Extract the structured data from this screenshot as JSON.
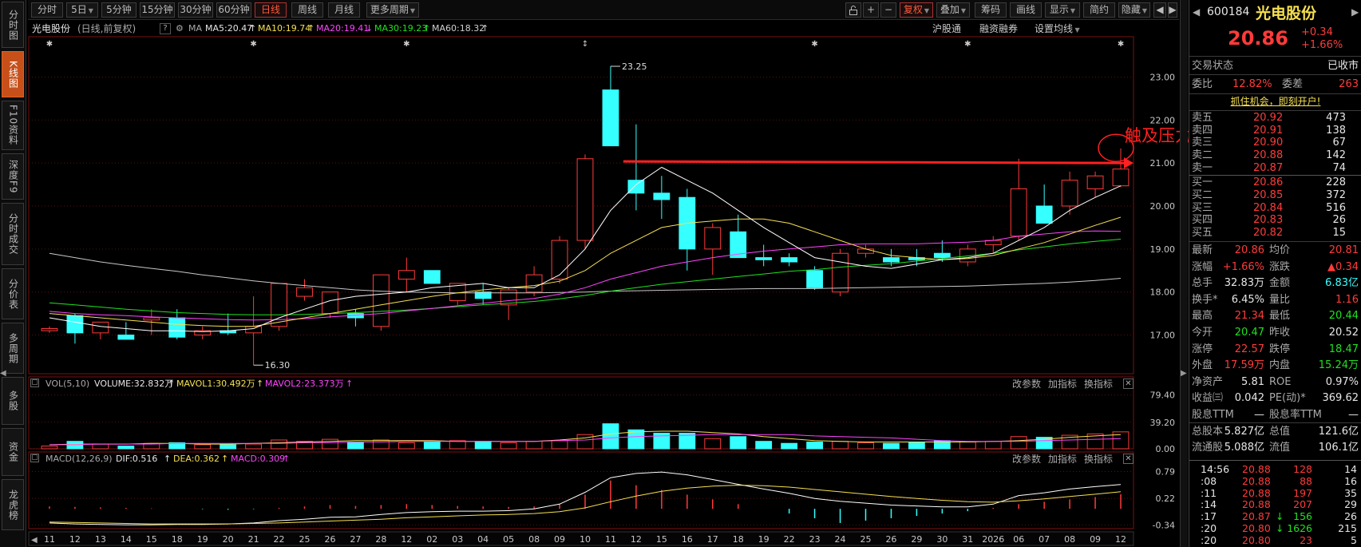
{
  "toolbar": {
    "left": [
      "分时",
      "5日",
      "5分钟",
      "15分钟",
      "30分钟",
      "60分钟",
      "日线",
      "周线",
      "月线",
      "更多周期"
    ],
    "right": [
      "复权",
      "叠加",
      "筹码",
      "画线",
      "显示",
      "简约",
      "隐藏"
    ],
    "icons": [
      "unlock-icon",
      "plus-icon",
      "minus-icon"
    ]
  },
  "left_tabs": [
    "分时图",
    "K线图",
    "F10资料",
    "深度F9",
    "分时成交",
    "分价表",
    "多周期",
    "多股",
    "资金",
    "龙虎榜"
  ],
  "header": {
    "stock_name": "光电股份",
    "mode": "(日线,前复权)",
    "ma_label": "MA",
    "ma5": "MA5:20.47",
    "ma10": "MA10:19.74",
    "ma20": "MA20:19.41",
    "ma30": "MA30:19.23",
    "ma60": "MA60:18.32",
    "links": [
      "沪股通",
      "融资融券",
      "设置均线"
    ]
  },
  "volume_header": {
    "label": "VOL(5,10)",
    "volume": "VOLUME:32.832万",
    "mavol1": "MAVOL1:30.492万",
    "mavol2": "MAVOL2:23.373万",
    "links": [
      "改参数",
      "加指标",
      "换指标"
    ]
  },
  "macd_header": {
    "label": "MACD(12,26,9)",
    "dif": "DIF:0.516",
    "dea": "DEA:0.362",
    "macd": "MACD:0.309",
    "links": [
      "改参数",
      "加指标",
      "换指标"
    ]
  },
  "annotation": {
    "text": "触及压力",
    "color": "#ff2020"
  },
  "colors": {
    "up": "#ff3b3b",
    "down": "#35ffff",
    "ma5": "#ffffff",
    "ma10": "#f5e050",
    "ma20": "#ff44ff",
    "ma30": "#1fe21f",
    "ma60": "#c8c8c8"
  },
  "chart_data": {
    "type": "candlestick",
    "x": [
      "11",
      "12",
      "13",
      "14",
      "15",
      "18",
      "19",
      "20",
      "21",
      "22",
      "25",
      "26",
      "27",
      "28",
      "12",
      "02",
      "03",
      "04",
      "05",
      "08",
      "09",
      "10",
      "11",
      "12",
      "15",
      "16",
      "17",
      "18",
      "19",
      "22",
      "23",
      "24",
      "25",
      "26",
      "29",
      "30",
      "31",
      "2026",
      "06",
      "07",
      "08",
      "09",
      "12"
    ],
    "x_labels": [
      "11",
      "12",
      "13",
      "14",
      "15",
      "18",
      "19",
      "20",
      "21",
      "22",
      "25",
      "26",
      "27",
      "28",
      "12",
      "02",
      "03",
      "04",
      "05",
      "08",
      "09",
      "10",
      "11",
      "12",
      "15",
      "16",
      "17",
      "18",
      "19",
      "22",
      "23",
      "24",
      "25",
      "26",
      "29",
      "30",
      "31",
      "2026",
      "06",
      "07",
      "08",
      "09",
      "12"
    ],
    "ohlc": [
      [
        17.1,
        17.2,
        17.05,
        17.15
      ],
      [
        17.45,
        17.5,
        16.8,
        17.05
      ],
      [
        17.05,
        17.2,
        16.9,
        17.3
      ],
      [
        17.0,
        17.3,
        16.95,
        16.9
      ],
      [
        17.35,
        17.6,
        17.0,
        17.4
      ],
      [
        17.4,
        17.6,
        16.9,
        16.95
      ],
      [
        17.0,
        17.2,
        16.9,
        17.1
      ],
      [
        17.1,
        17.5,
        17.0,
        17.05
      ],
      [
        17.05,
        17.9,
        16.3,
        17.2
      ],
      [
        17.2,
        18.2,
        17.1,
        18.2
      ],
      [
        17.9,
        18.3,
        17.8,
        18.1
      ],
      [
        17.5,
        18.0,
        17.4,
        18.0
      ],
      [
        17.5,
        17.6,
        17.2,
        17.4
      ],
      [
        17.2,
        18.4,
        17.1,
        18.4
      ],
      [
        18.3,
        18.8,
        18.0,
        18.5
      ],
      [
        18.5,
        18.5,
        18.2,
        18.2
      ],
      [
        17.8,
        18.2,
        17.7,
        18.2
      ],
      [
        18.0,
        18.2,
        17.7,
        17.85
      ],
      [
        17.7,
        18.1,
        17.35,
        18.05
      ],
      [
        18.0,
        18.6,
        17.9,
        18.4
      ],
      [
        18.3,
        19.3,
        18.2,
        19.2
      ],
      [
        19.2,
        21.2,
        19.0,
        21.1
      ],
      [
        22.7,
        23.25,
        21.4,
        21.4
      ],
      [
        20.6,
        21.9,
        19.9,
        20.3
      ],
      [
        20.3,
        20.7,
        19.7,
        20.15
      ],
      [
        20.2,
        20.4,
        18.5,
        19.0
      ],
      [
        19.0,
        19.6,
        18.4,
        19.5
      ],
      [
        19.4,
        19.8,
        18.9,
        18.8
      ],
      [
        18.8,
        19.1,
        18.6,
        18.75
      ],
      [
        18.8,
        18.9,
        18.6,
        18.7
      ],
      [
        18.5,
        18.6,
        18.05,
        18.1
      ],
      [
        18.0,
        19.0,
        17.9,
        18.9
      ],
      [
        18.9,
        19.1,
        18.8,
        19.0
      ],
      [
        18.8,
        19.0,
        18.6,
        18.7
      ],
      [
        18.8,
        19.0,
        18.6,
        18.75
      ],
      [
        18.9,
        19.2,
        18.7,
        18.8
      ],
      [
        18.7,
        19.1,
        18.6,
        19.0
      ],
      [
        19.1,
        19.3,
        18.9,
        19.2
      ],
      [
        19.3,
        21.1,
        19.2,
        20.4
      ],
      [
        20.0,
        20.5,
        19.6,
        19.6
      ],
      [
        20.0,
        20.8,
        19.8,
        20.6
      ],
      [
        20.4,
        20.8,
        20.2,
        20.7
      ],
      [
        20.47,
        21.34,
        20.44,
        20.86
      ]
    ],
    "ma5": [
      17.4,
      17.3,
      17.2,
      17.15,
      17.1,
      17.1,
      17.08,
      17.1,
      17.15,
      17.4,
      17.6,
      17.8,
      17.9,
      17.95,
      18.0,
      18.1,
      18.15,
      18.2,
      18.1,
      18.1,
      18.4,
      19.0,
      19.9,
      20.5,
      20.9,
      20.6,
      20.3,
      19.9,
      19.5,
      19.15,
      18.8,
      18.7,
      18.6,
      18.55,
      18.65,
      18.75,
      18.8,
      18.9,
      19.2,
      19.5,
      19.9,
      20.2,
      20.47
    ],
    "ma10": [
      17.5,
      17.45,
      17.4,
      17.35,
      17.3,
      17.25,
      17.22,
      17.2,
      17.2,
      17.3,
      17.4,
      17.5,
      17.6,
      17.7,
      17.8,
      17.9,
      17.98,
      18.05,
      18.1,
      18.15,
      18.25,
      18.5,
      18.9,
      19.2,
      19.5,
      19.6,
      19.65,
      19.7,
      19.7,
      19.6,
      19.4,
      19.2,
      19.0,
      18.85,
      18.8,
      18.75,
      18.78,
      18.85,
      19.0,
      19.15,
      19.35,
      19.55,
      19.74
    ],
    "ma20": [
      17.55,
      17.5,
      17.47,
      17.45,
      17.42,
      17.4,
      17.38,
      17.36,
      17.35,
      17.36,
      17.38,
      17.42,
      17.46,
      17.5,
      17.56,
      17.62,
      17.68,
      17.74,
      17.8,
      17.85,
      17.95,
      18.1,
      18.3,
      18.45,
      18.6,
      18.7,
      18.8,
      18.88,
      18.95,
      19.0,
      19.05,
      19.1,
      19.12,
      19.12,
      19.12,
      19.14,
      19.16,
      19.2,
      19.3,
      19.35,
      19.4,
      19.42,
      19.41
    ],
    "ma30": [
      17.75,
      17.7,
      17.65,
      17.6,
      17.56,
      17.52,
      17.5,
      17.48,
      17.47,
      17.47,
      17.48,
      17.5,
      17.52,
      17.55,
      17.58,
      17.62,
      17.66,
      17.7,
      17.74,
      17.78,
      17.84,
      17.92,
      18.02,
      18.1,
      18.18,
      18.24,
      18.3,
      18.36,
      18.42,
      18.48,
      18.52,
      18.58,
      18.62,
      18.66,
      18.72,
      18.78,
      18.84,
      18.9,
      18.98,
      19.05,
      19.12,
      19.18,
      19.23
    ],
    "ma60": [
      18.9,
      18.8,
      18.7,
      18.62,
      18.55,
      18.48,
      18.4,
      18.33,
      18.26,
      18.2,
      18.15,
      18.1,
      18.05,
      18.02,
      18.0,
      17.99,
      17.98,
      17.98,
      17.98,
      17.98,
      17.99,
      18.0,
      18.02,
      18.03,
      18.04,
      18.05,
      18.06,
      18.07,
      18.08,
      18.08,
      18.08,
      18.09,
      18.1,
      18.11,
      18.12,
      18.13,
      18.14,
      18.16,
      18.18,
      18.2,
      18.23,
      18.27,
      18.32
    ],
    "price_ticks": [
      23.0,
      22.0,
      21.0,
      20.0,
      19.0,
      18.0,
      17.0
    ],
    "price_tick_labels": [
      "23.00",
      "22.00",
      "21.00",
      "20.00",
      "19.00",
      "18.00",
      "17.00"
    ],
    "ylim": [
      16.1,
      23.9
    ],
    "high_label": "23.25",
    "low_label": "16.30",
    "resistance_level": 21.0,
    "volume": [
      4,
      11,
      7,
      4,
      8,
      9,
      6,
      6,
      7,
      13,
      11,
      14,
      10,
      13,
      9,
      10,
      12,
      11,
      9,
      11,
      12,
      21,
      37,
      28,
      23,
      23,
      15,
      18,
      11,
      8,
      10,
      11,
      9,
      8,
      9,
      12,
      10,
      11,
      18,
      17,
      20,
      22,
      25
    ],
    "vol_ma1": [
      6,
      7,
      7,
      7,
      8,
      8,
      7,
      7,
      8,
      9,
      10,
      11,
      12,
      12,
      12,
      12,
      11,
      11,
      11,
      11,
      13,
      16,
      22,
      25,
      26,
      26,
      24,
      22,
      18,
      15,
      12,
      11,
      10,
      10,
      10,
      10,
      10,
      11,
      12,
      14,
      17,
      19,
      21
    ],
    "vol_ma2": [
      6,
      6,
      7,
      7,
      7,
      8,
      8,
      8,
      8,
      8,
      9,
      9,
      10,
      10,
      11,
      11,
      11,
      11,
      11,
      11,
      12,
      13,
      16,
      18,
      19,
      20,
      21,
      21,
      21,
      21,
      19,
      18,
      17,
      16,
      14,
      12,
      11,
      11,
      11,
      12,
      13,
      14,
      15
    ],
    "vol_ticks": [
      79.4,
      39.2,
      0
    ],
    "vol_tick_labels": [
      "79.40",
      "39.20",
      "0.00"
    ],
    "vol_max": 85,
    "macd_bars": [
      0.05,
      0.04,
      0.03,
      0.02,
      0.01,
      0.0,
      -0.01,
      -0.02,
      -0.01,
      0.02,
      0.05,
      0.08,
      0.06,
      0.08,
      0.1,
      0.08,
      0.06,
      0.05,
      0.04,
      0.05,
      0.1,
      0.3,
      0.6,
      0.5,
      0.4,
      0.3,
      0.2,
      0.1,
      0.0,
      -0.1,
      -0.2,
      -0.3,
      -0.25,
      -0.2,
      -0.15,
      -0.1,
      -0.05,
      0.02,
      0.1,
      0.15,
      0.2,
      0.25,
      0.309
    ],
    "dif": [
      -0.3,
      -0.32,
      -0.33,
      -0.34,
      -0.34,
      -0.33,
      -0.33,
      -0.32,
      -0.3,
      -0.25,
      -0.22,
      -0.18,
      -0.17,
      -0.12,
      -0.08,
      -0.06,
      -0.05,
      -0.05,
      -0.04,
      0.0,
      0.1,
      0.35,
      0.66,
      0.75,
      0.78,
      0.72,
      0.62,
      0.52,
      0.42,
      0.33,
      0.22,
      0.16,
      0.12,
      0.08,
      0.06,
      0.04,
      0.04,
      0.1,
      0.28,
      0.34,
      0.42,
      0.47,
      0.516
    ],
    "dea": [
      -0.28,
      -0.29,
      -0.3,
      -0.31,
      -0.32,
      -0.32,
      -0.32,
      -0.32,
      -0.31,
      -0.3,
      -0.28,
      -0.26,
      -0.24,
      -0.22,
      -0.19,
      -0.17,
      -0.15,
      -0.13,
      -0.12,
      -0.1,
      -0.06,
      0.02,
      0.15,
      0.27,
      0.37,
      0.44,
      0.48,
      0.5,
      0.49,
      0.46,
      0.41,
      0.36,
      0.31,
      0.26,
      0.22,
      0.18,
      0.15,
      0.14,
      0.17,
      0.21,
      0.26,
      0.31,
      0.362
    ],
    "macd_ticks": [
      0.79,
      0.22,
      -0.34
    ],
    "macd_tick_labels": [
      "0.79",
      "0.22",
      "-0.34"
    ],
    "macd_range": [
      -0.42,
      0.9
    ],
    "grid": true
  },
  "quote": {
    "code": "600184",
    "name": "光电股份",
    "price": "20.86",
    "change": "+0.34",
    "change_pct": "+1.66%",
    "status_label": "交易状态",
    "status_value": "已收市",
    "wb_label": "委比",
    "wb_value": "12.82%",
    "wc_label": "委差",
    "wc_value": "263",
    "promo": "抓住机会，即刻开户!",
    "sells": [
      {
        "label": "卖五",
        "price": "20.92",
        "vol": "473"
      },
      {
        "label": "卖四",
        "price": "20.91",
        "vol": "138"
      },
      {
        "label": "卖三",
        "price": "20.90",
        "vol": "67"
      },
      {
        "label": "卖二",
        "price": "20.88",
        "vol": "142"
      },
      {
        "label": "卖一",
        "price": "20.87",
        "vol": "74"
      }
    ],
    "buys": [
      {
        "label": "买一",
        "price": "20.86",
        "vol": "228"
      },
      {
        "label": "买二",
        "price": "20.85",
        "vol": "372"
      },
      {
        "label": "买三",
        "price": "20.84",
        "vol": "516"
      },
      {
        "label": "买四",
        "price": "20.83",
        "vol": "26"
      },
      {
        "label": "买五",
        "price": "20.82",
        "vol": "15"
      }
    ],
    "stats": [
      [
        "最新",
        "20.86",
        "red",
        "均价",
        "20.81",
        "red"
      ],
      [
        "涨幅",
        "+1.66%",
        "red",
        "涨跌",
        "▲0.34",
        "red"
      ],
      [
        "总手",
        "32.83万",
        "white",
        "金额",
        "6.83亿",
        "cyan"
      ],
      [
        "换手*",
        "6.45%",
        "white",
        "量比",
        "1.16",
        "red"
      ],
      [
        "最高",
        "21.34",
        "red",
        "最低",
        "20.44",
        "green"
      ],
      [
        "今开",
        "20.47",
        "green",
        "昨收",
        "20.52",
        "white"
      ],
      [
        "涨停",
        "22.57",
        "red",
        "跌停",
        "18.47",
        "green"
      ],
      [
        "外盘",
        "17.59万",
        "red",
        "内盘",
        "15.24万",
        "green"
      ],
      [
        "净资产",
        "5.81",
        "white",
        "ROE",
        "0.97%",
        "white"
      ],
      [
        "收益㈢",
        "0.042",
        "white",
        "PE(动)*",
        "369.62",
        "white"
      ],
      [
        "股息TTM",
        "—",
        "white",
        "股息率TTM",
        "—",
        "white"
      ],
      [
        "总股本",
        "5.827亿",
        "white",
        "总值",
        "121.6亿",
        "white"
      ],
      [
        "流通股",
        "5.088亿",
        "white",
        "流值",
        "106.1亿",
        "white"
      ]
    ],
    "ticks": [
      {
        "time": "14:56",
        "price": "20.88",
        "vol": "128",
        "n": "14",
        "arrow": ""
      },
      {
        "time": ":08",
        "price": "20.88",
        "vol": "88",
        "n": "16",
        "arrow": ""
      },
      {
        "time": ":11",
        "price": "20.88",
        "vol": "197",
        "n": "35",
        "arrow": ""
      },
      {
        "time": ":14",
        "price": "20.88",
        "vol": "207",
        "n": "29",
        "arrow": ""
      },
      {
        "time": ":17",
        "price": "20.87",
        "vol": "156",
        "n": "26",
        "arrow": "↓"
      },
      {
        "time": ":20",
        "price": "20.80",
        "vol": "1626",
        "n": "215",
        "arrow": "↓"
      },
      {
        "time": ":20",
        "price": "20.80",
        "vol": "23",
        "n": "5",
        "arrow": ""
      }
    ]
  }
}
